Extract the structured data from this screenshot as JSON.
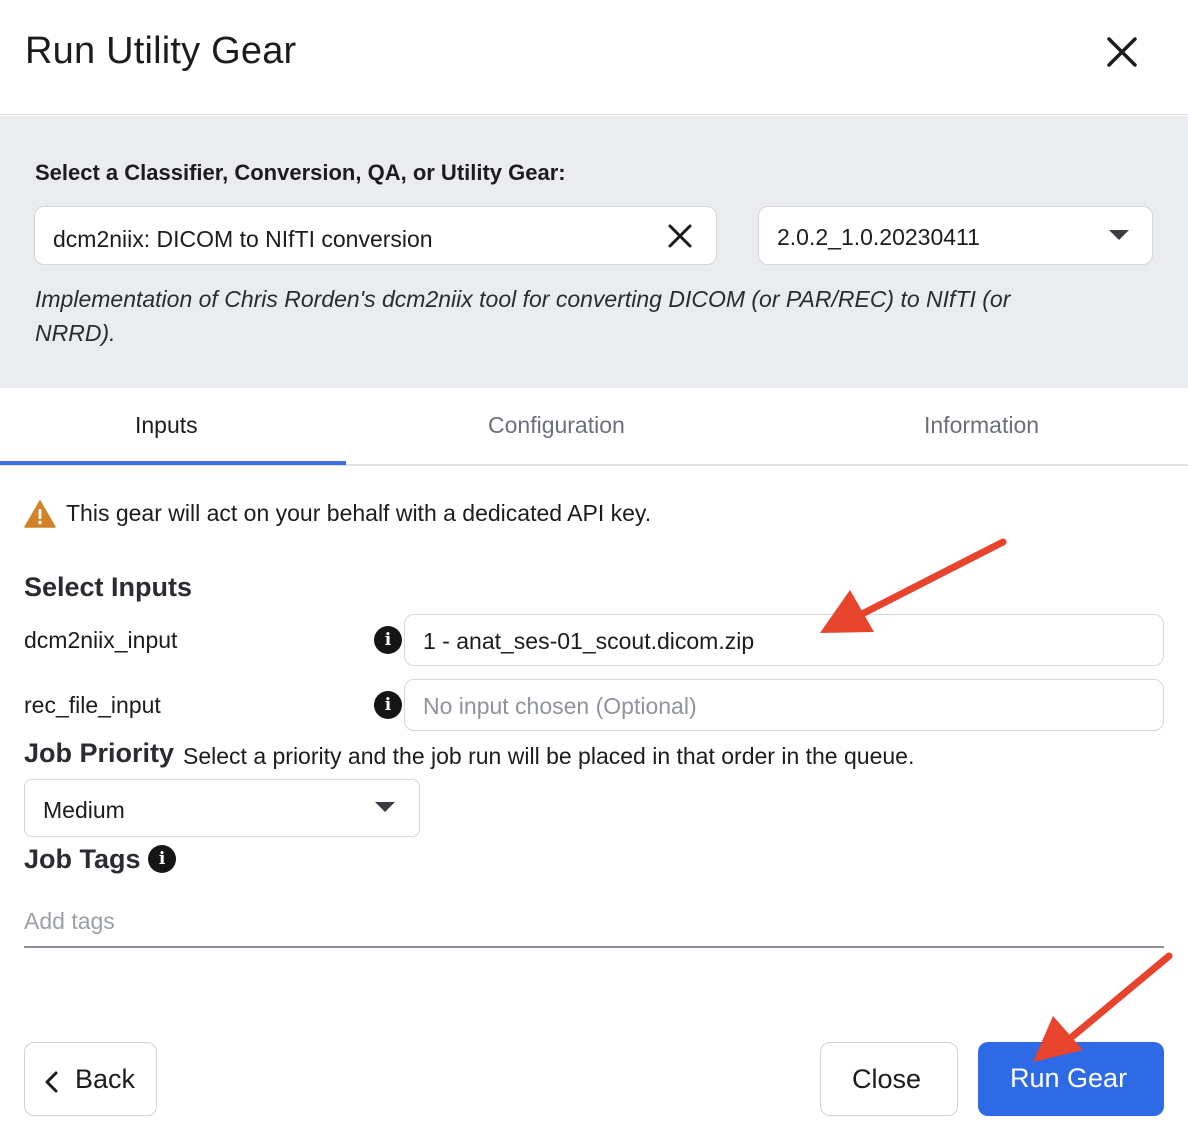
{
  "dialog": {
    "title": "Run Utility Gear"
  },
  "gear_selector": {
    "label": "Select a Classifier, Conversion, QA, or Utility Gear:",
    "selected_gear": "dcm2niix: DICOM to NIfTI conversion",
    "version": "2.0.2_1.0.20230411",
    "description_line1": "Implementation of Chris Rorden's dcm2niix tool for converting DICOM (or PAR/REC) to NIfTI (or",
    "description_line2": "NRRD)."
  },
  "tabs": [
    {
      "label": "Inputs",
      "active": true
    },
    {
      "label": "Configuration",
      "active": false
    },
    {
      "label": "Information",
      "active": false
    }
  ],
  "warning": {
    "icon": "warning-triangle-icon",
    "text": "This gear will act on your behalf with a dedicated API key."
  },
  "inputs": {
    "section_title": "Select Inputs",
    "fields": [
      {
        "label": "dcm2niix_input",
        "value": "1 - anat_ses-01_scout.dicom.zip",
        "placeholder": ""
      },
      {
        "label": "rec_file_input",
        "value": "",
        "placeholder": "No input chosen (Optional)"
      }
    ]
  },
  "job_priority": {
    "title": "Job Priority",
    "description": "Select a priority and the job run will be placed in that order in the queue.",
    "selected": "Medium"
  },
  "job_tags": {
    "title": "Job Tags",
    "placeholder": "Add tags"
  },
  "footer": {
    "back_label": "Back",
    "close_label": "Close",
    "run_label": "Run Gear"
  },
  "colors": {
    "primary": "#2f6ae6",
    "tab_underline": "#3d6fe0",
    "warning": "#d4822a",
    "annotation_arrow": "#e8432c",
    "panel_bg": "#eaecf0"
  }
}
